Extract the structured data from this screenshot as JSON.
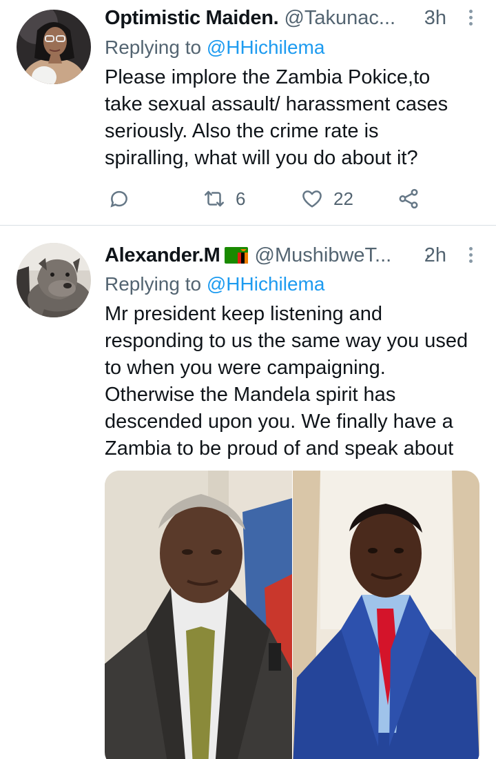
{
  "tweets": [
    {
      "display_name": "Optimistic Maiden.",
      "handle": "@Takunac...",
      "dot": "·",
      "time": "3h",
      "replying_prefix": "Replying to ",
      "replying_to": "@HHichilema",
      "text_lines": [
        "Please implore the Zambia Pokice,to",
        "take sexual assault/ harassment cases",
        "seriously.  Also the crime rate is",
        "spiralling, what will you do about it?"
      ],
      "retweets": "6",
      "likes": "22"
    },
    {
      "display_name": "Alexander.M",
      "handle": "@MushibweT...",
      "dot": "·",
      "time": "2h",
      "replying_prefix": "Replying to ",
      "replying_to": "@HHichilema",
      "text_lines": [
        "Mr president keep listening and",
        "responding to us the same way you used",
        "to when you were campaigning.",
        "Otherwise the Mandela spirit has",
        "descended upon you. We finally have a",
        "Zambia to be proud of and speak about"
      ]
    }
  ],
  "icons": {
    "reply": "reply-icon",
    "retweet": "retweet-icon",
    "like": "heart-icon",
    "share": "share-icon",
    "more": "more-vertical-icon"
  },
  "colors": {
    "text": "#0f1419",
    "secondary": "#536471",
    "link": "#1d9bf0",
    "divider": "#d9dfe4",
    "icon": "#657786"
  }
}
